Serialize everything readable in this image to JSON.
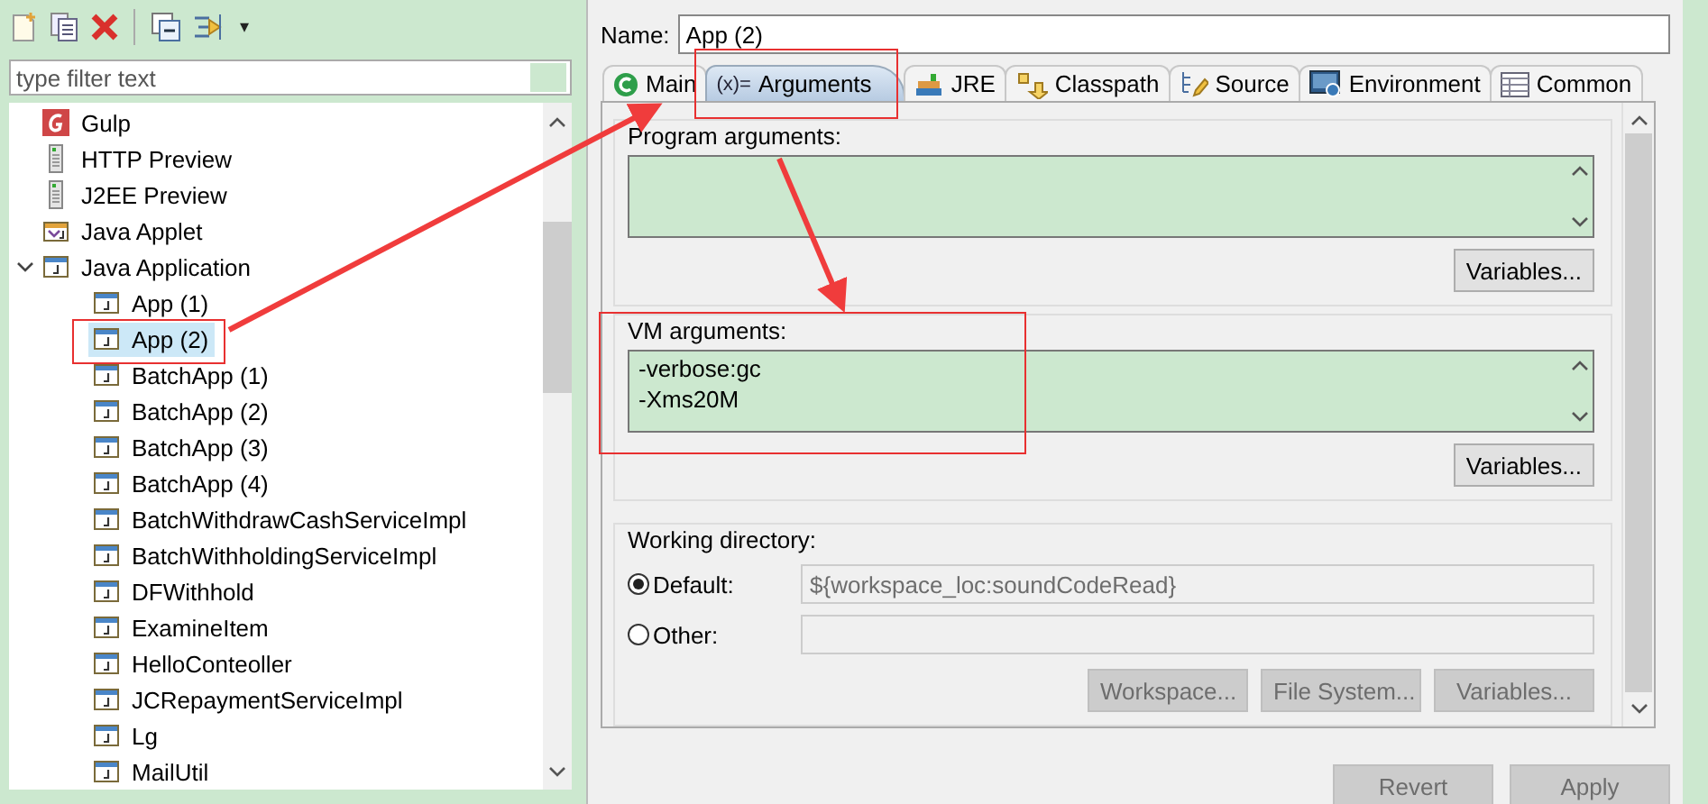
{
  "toolbar": {
    "menu_caret": "▾"
  },
  "filter": {
    "placeholder": "type filter text"
  },
  "tree": [
    {
      "label": "Gulp",
      "kind": "gulp",
      "selected": false
    },
    {
      "label": "HTTP Preview",
      "kind": "server",
      "selected": false
    },
    {
      "label": "J2EE Preview",
      "kind": "server",
      "selected": false
    },
    {
      "label": "Java Applet",
      "kind": "applet",
      "selected": false
    },
    {
      "label": "Java Application",
      "kind": "app",
      "selected": false,
      "expanded": true,
      "children": [
        {
          "label": "App (1)",
          "kind": "app",
          "selected": false
        },
        {
          "label": "App (2)",
          "kind": "app",
          "selected": true
        },
        {
          "label": "BatchApp (1)",
          "kind": "app",
          "selected": false
        },
        {
          "label": "BatchApp (2)",
          "kind": "app",
          "selected": false
        },
        {
          "label": "BatchApp (3)",
          "kind": "app",
          "selected": false
        },
        {
          "label": "BatchApp (4)",
          "kind": "app",
          "selected": false
        },
        {
          "label": "BatchWithdrawCashServiceImpl",
          "kind": "app",
          "selected": false
        },
        {
          "label": "BatchWithholdingServiceImpl",
          "kind": "app",
          "selected": false
        },
        {
          "label": "DFWithhold",
          "kind": "app",
          "selected": false
        },
        {
          "label": "ExamineItem",
          "kind": "app",
          "selected": false
        },
        {
          "label": "HelloConteoller",
          "kind": "app",
          "selected": false
        },
        {
          "label": "JCRepaymentServiceImpl",
          "kind": "app",
          "selected": false
        },
        {
          "label": "Lg",
          "kind": "app",
          "selected": false
        },
        {
          "label": "MailUtil",
          "kind": "app",
          "selected": false
        }
      ]
    }
  ],
  "name": {
    "label": "Name:",
    "value": "App (2)"
  },
  "tabs": [
    {
      "label": "Main",
      "selected": false
    },
    {
      "label": "Arguments",
      "icon_text": "(x)=",
      "selected": true
    },
    {
      "label": "JRE",
      "selected": false
    },
    {
      "label": "Classpath",
      "selected": false
    },
    {
      "label": "Source",
      "selected": false
    },
    {
      "label": "Environment",
      "selected": false
    },
    {
      "label": "Common",
      "selected": false
    }
  ],
  "program_arguments": {
    "label": "Program arguments:",
    "button": "Variables..."
  },
  "vm_arguments": {
    "label": "VM arguments:",
    "value": "-verbose:gc\n-Xms20M",
    "button": "Variables..."
  },
  "working_directory": {
    "label": "Working directory:",
    "options": [
      {
        "label": "Default:",
        "selected": true,
        "value": "${workspace_loc:soundCodeRead}",
        "disabled": true
      },
      {
        "label": "Other:",
        "selected": false
      }
    ],
    "buttons": [
      {
        "label": "Workspace...",
        "disabled": true
      },
      {
        "label": "File System...",
        "disabled": true
      },
      {
        "label": "Variables...",
        "disabled": true
      }
    ]
  },
  "footer_buttons": [
    {
      "label": "Revert",
      "disabled": true
    },
    {
      "label": "Apply",
      "disabled": true
    }
  ]
}
